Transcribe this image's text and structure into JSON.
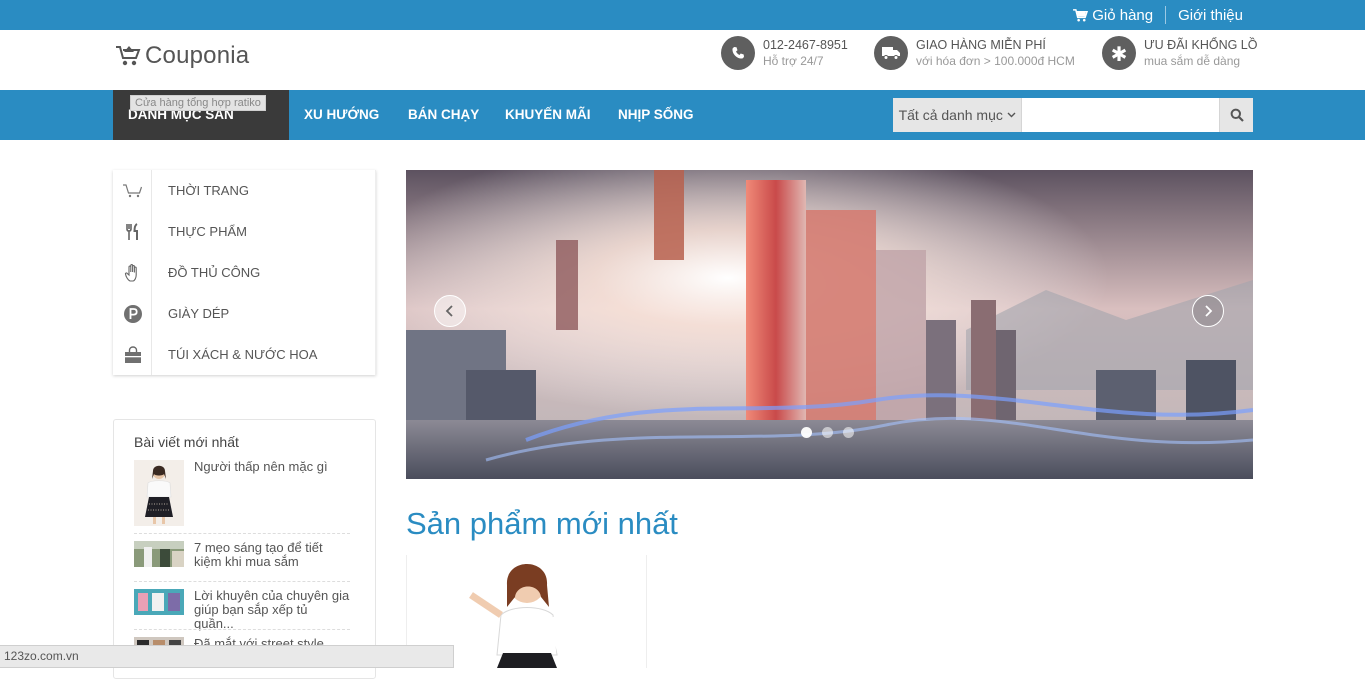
{
  "topbar": {
    "cart_label": "Giỏ hàng",
    "about_label": "Giới thiệu"
  },
  "header": {
    "logo_text": "Couponia",
    "phone": {
      "title": "012-2467-8951",
      "subtitle": "Hỗ trợ 24/7",
      "icon": "phone-icon"
    },
    "shipping": {
      "title": "GIAO HÀNG MIỄN PHÍ",
      "subtitle": "với hóa đơn > 100.000đ HCM",
      "icon": "truck-icon"
    },
    "promo": {
      "title": "ƯU ĐÃI KHỔNG LỒ",
      "subtitle": "mua sắm dễ dàng",
      "icon": "asterisk-icon"
    }
  },
  "nav": {
    "items": [
      "DANH MỤC SẢN PHẨM",
      "XU HƯỚNG",
      "BÁN CHẠY",
      "KHUYẾN MÃI",
      "NHỊP SỐNG"
    ],
    "tooltip": "Cửa hàng tổng hợp ratiko",
    "search_category": "Tất cả danh mục",
    "search_placeholder": ""
  },
  "categories": [
    {
      "label": "THỜI TRANG",
      "icon": "cart-icon"
    },
    {
      "label": "THỰC PHẨM",
      "icon": "fork-knife-icon"
    },
    {
      "label": "ĐỒ THỦ CÔNG",
      "icon": "hand-icon"
    },
    {
      "label": "GIÀY DÉP",
      "icon": "parking-icon"
    },
    {
      "label": "TÚI XÁCH & NƯỚC HOA",
      "icon": "bag-icon"
    }
  ],
  "blog": {
    "title": "Bài viết mới nhất",
    "posts": [
      {
        "title": "Người thấp nên mặc gì"
      },
      {
        "title": "7 mẹo sáng tạo để tiết kiệm khi mua sắm"
      },
      {
        "title": "Lời khuyên của chuyên gia giúp bạn sắp xếp tủ quần..."
      },
      {
        "title": "Đã mắt với street style đầu..."
      }
    ]
  },
  "slider": {
    "dot_count": 3,
    "active_dot": 0
  },
  "section": {
    "title": "Sản phẩm mới nhất"
  },
  "statusbar": {
    "text": "123zo.com.vn"
  },
  "colors": {
    "primary": "#2a8cc2",
    "dark": "#3a3a3a",
    "icon_bg": "#5f5f5f"
  }
}
